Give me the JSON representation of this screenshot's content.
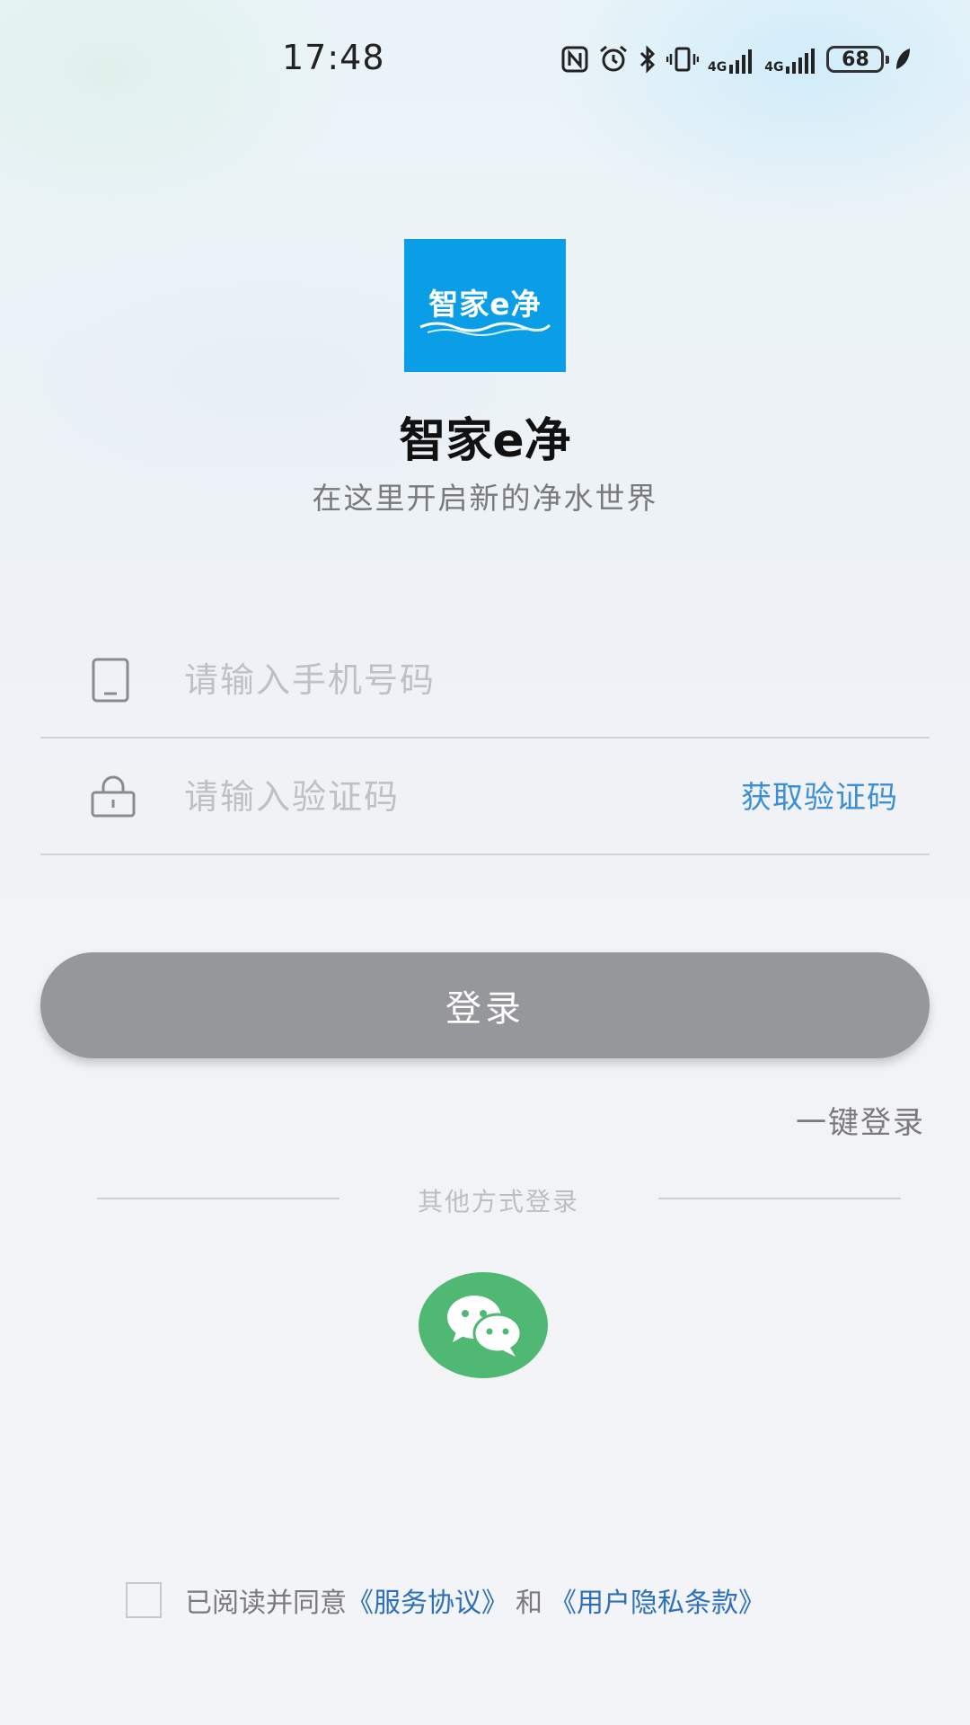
{
  "status_bar": {
    "time": "17:48",
    "network_1": "4G",
    "network_2": "4G",
    "battery": "68"
  },
  "app": {
    "logo_text": "智家e净",
    "name": "智家e净",
    "slogan": "在这里开启新的净水世界"
  },
  "form": {
    "phone_placeholder": "请输入手机号码",
    "phone_value": "",
    "code_placeholder": "请输入验证码",
    "code_value": "",
    "get_code_label": "获取验证码"
  },
  "login": {
    "button_label": "登录",
    "one_click_label": "一键登录"
  },
  "other_login": {
    "label": "其他方式登录",
    "wechat_icon": "wechat-icon"
  },
  "agreement": {
    "checked": false,
    "prefix": "已阅读并同意",
    "service_link": "《服务协议》",
    "and": "和",
    "privacy_link": "《用户隐私条款》"
  },
  "colors": {
    "logo_bg": "#0a9ee6",
    "link": "#3a8fd6",
    "button_disabled": "#96979b",
    "wechat": "#4fb873"
  }
}
